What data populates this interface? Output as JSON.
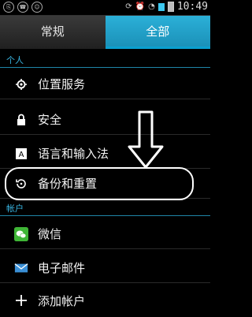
{
  "status_bar": {
    "time": "10:49",
    "left_icons": [
      "usb-icon",
      "notification-icon",
      "android-icon"
    ],
    "right_icons": [
      "sync-icon",
      "alarm-icon",
      "wifi-icon",
      "signal-icon",
      "battery-icon"
    ]
  },
  "tabs": [
    {
      "label": "常规",
      "active": false
    },
    {
      "label": "全部",
      "active": true
    }
  ],
  "sections": {
    "personal": {
      "header": "个人",
      "items": [
        {
          "label": "位置服务",
          "icon": "location-icon"
        },
        {
          "label": "安全",
          "icon": "lock-icon"
        },
        {
          "label": "语言和输入法",
          "icon": "keyboard-icon"
        },
        {
          "label": "备份和重置",
          "icon": "restore-icon"
        }
      ]
    },
    "accounts": {
      "header": "帐户",
      "items": [
        {
          "label": "微信",
          "icon": "wechat-icon"
        },
        {
          "label": "电子邮件",
          "icon": "email-icon"
        },
        {
          "label": "添加帐户",
          "icon": "add-icon"
        }
      ]
    }
  },
  "colors": {
    "accent": "#39b6e3",
    "active_tab": "#1a8fb6"
  }
}
